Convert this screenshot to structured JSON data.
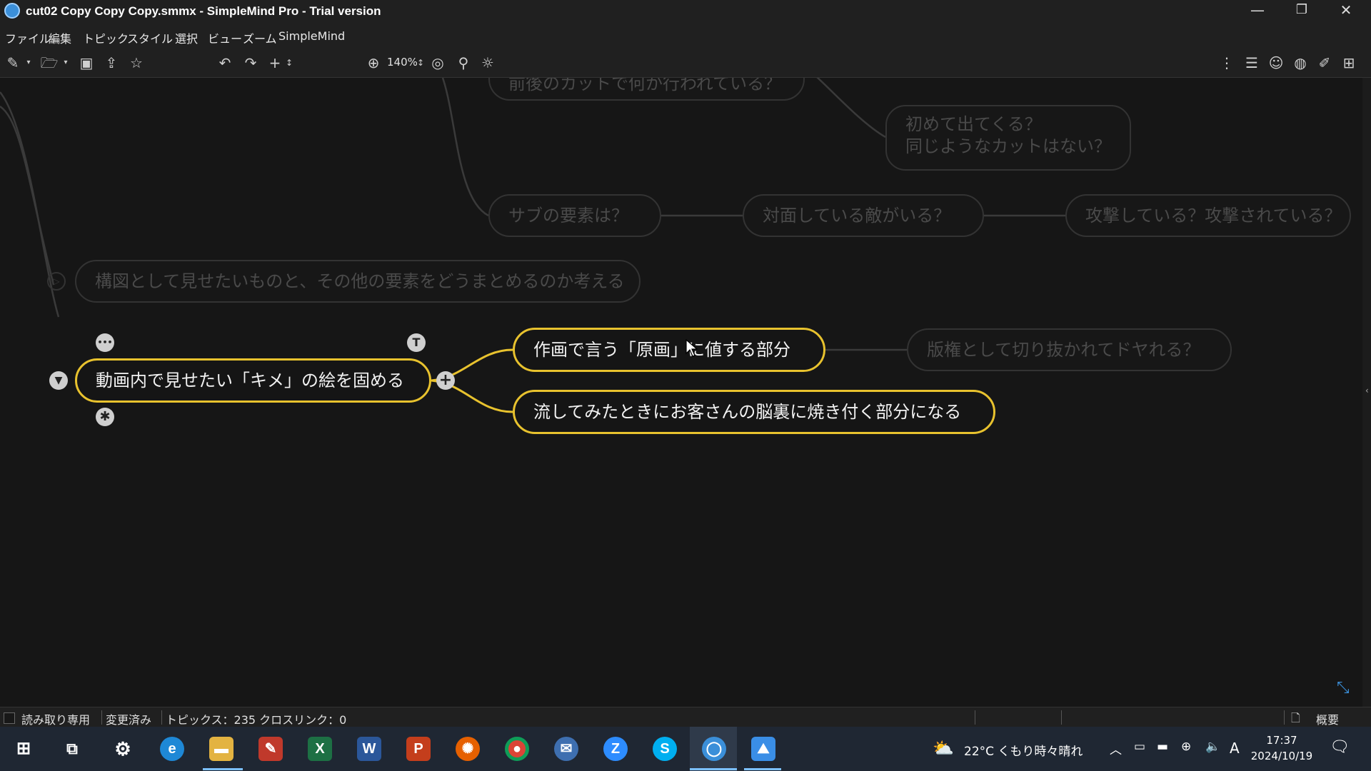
{
  "window": {
    "title": "cut02 Copy Copy Copy.smmx - SimpleMind Pro - Trial version",
    "minimize": "—",
    "maximize": "❐",
    "close": "✕"
  },
  "menu": [
    "ファイル",
    "編集",
    "トピック",
    "スタイル",
    "選択",
    "ビュー",
    "ズーム",
    "SimpleMind"
  ],
  "toolbar": {
    "zoom_level": "140%"
  },
  "nodes": {
    "top_partial": "前後のカットで何か行われている？",
    "first_appear": [
      "初めて出てくる？",
      "同じようなカットはない？"
    ],
    "sub_element": "サブの要素は？",
    "enemy": "対面している敵がいる？",
    "attack": "攻撃している？攻撃されている？",
    "composition": "構図として見せたいものと、その他の要素をどうまとめるのか考える",
    "main": "動画内で見せたい「キメ」の絵を固める",
    "genga": "作画で言う「原画」に値する部分",
    "copyright": "版権として切り抜かれてドヤれる？",
    "impression": "流してみたときにお客さんの脳裏に焼き付く部分になる"
  },
  "node_controls": {
    "more": "•••",
    "text": "T",
    "collapse": "▼",
    "add": "+",
    "star": "✱"
  },
  "status": {
    "readonly": "読み取り専用",
    "modified": "変更済み",
    "topics": "トピックス：235 クロスリンク：0",
    "outline": "概要"
  },
  "taskbar": {
    "weather": "22°C くもり時々晴れ",
    "ime": "A",
    "time": "17:37",
    "date": "2024/10/19"
  },
  "colors": {
    "accent": "#e8c22e",
    "background": "#161616",
    "chrome": "#202020"
  }
}
